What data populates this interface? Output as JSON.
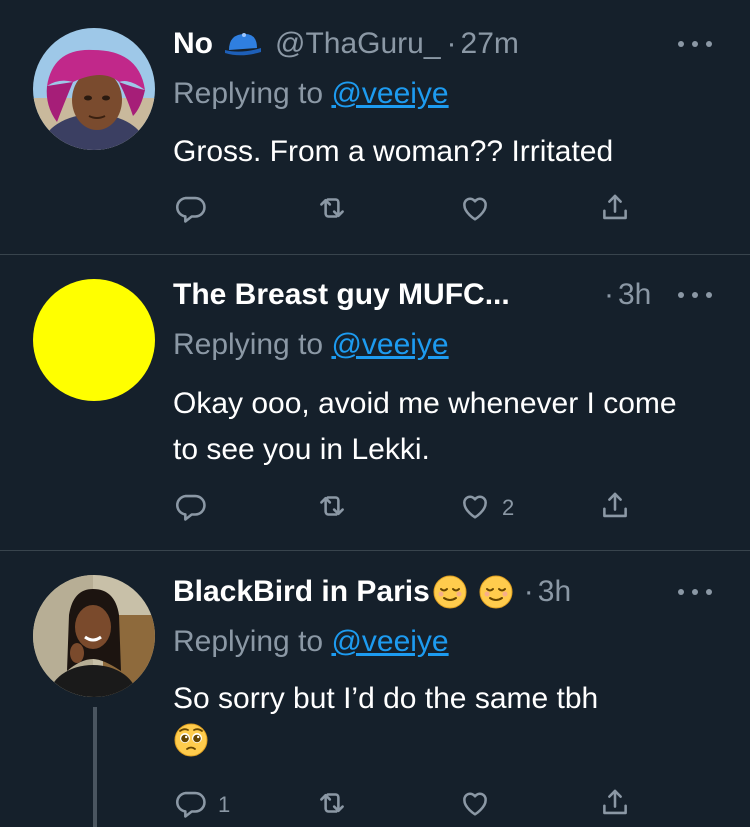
{
  "tweets": [
    {
      "name": "No",
      "handle": "@ThaGuru_",
      "sep": "·",
      "time": "27m",
      "replying_prefix": "Replying to",
      "replying_to": "@veeiye",
      "text": "Gross. From a woman?? Irritated",
      "reply_count": "",
      "retweet_count": "",
      "like_count": ""
    },
    {
      "name": "The Breast guy MUFC...",
      "sep": "·",
      "time": "3h",
      "replying_prefix": "Replying to",
      "replying_to": "@veeiye",
      "text": "Okay ooo, avoid me whenever I come to see you in Lekki.",
      "reply_count": "",
      "retweet_count": "",
      "like_count": "2"
    },
    {
      "name": "BlackBird in Paris",
      "sep": "·",
      "time": "3h",
      "replying_prefix": "Replying to",
      "replying_to": "@veeiye",
      "text": "So sorry but I’d do the same tbh",
      "reply_count": "1",
      "retweet_count": "",
      "like_count": ""
    }
  ],
  "icons": {
    "badge": "blue-cap-icon",
    "reply": "reply-icon",
    "retweet": "retweet-icon",
    "like": "heart-icon",
    "share": "share-icon",
    "more": "more-icon",
    "relieved_face": "relieved-face-emoji",
    "pleading_face": "pleading-face-emoji"
  },
  "colors": {
    "background": "#15202b",
    "separator": "#38444d",
    "muted_text": "#8b98a5",
    "link": "#1d9bf0",
    "avatar_yellow": "#ffff00"
  }
}
